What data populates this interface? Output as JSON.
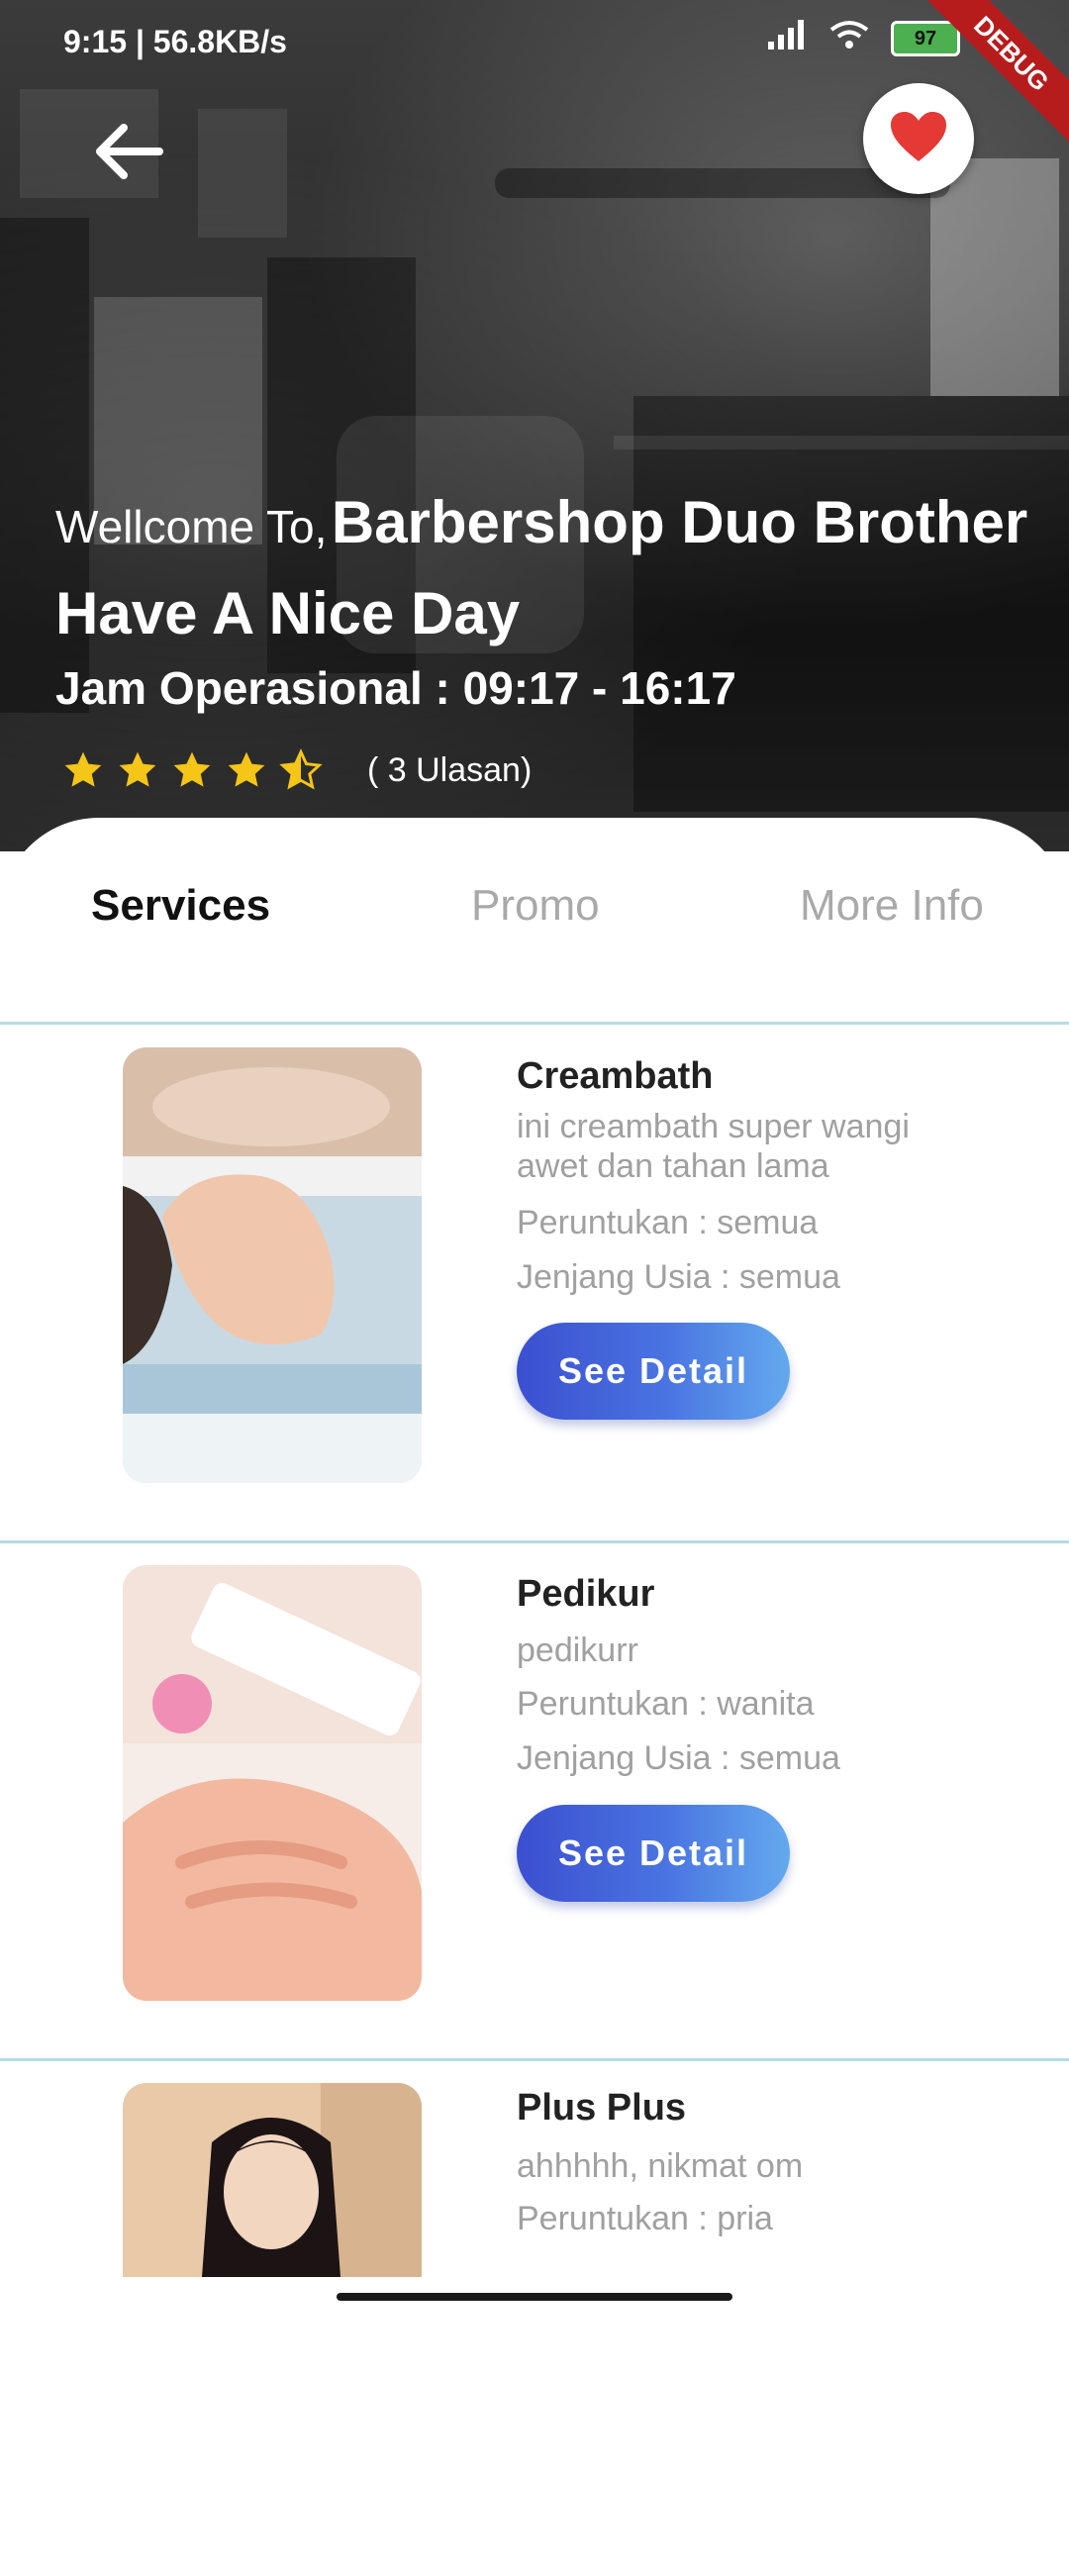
{
  "status_bar": {
    "time_speed": "9:15 | 56.8KB/s",
    "battery": "97"
  },
  "debug_label": "DEBUG",
  "header": {
    "welcome_prefix": "Wellcome To,",
    "shop_name": "Barbershop Duo Brother",
    "greeting": "Have A Nice Day",
    "hours": "Jam Operasional : 09:17 - 16:17",
    "rating": 4.5,
    "reviews": "( 3 Ulasan)"
  },
  "tabs": [
    {
      "label": "Services"
    },
    {
      "label": "Promo"
    },
    {
      "label": "More Info"
    }
  ],
  "services": [
    {
      "name": "Creambath",
      "description": "ini creambath super wangi awet dan tahan lama",
      "for": "Peruntukan : semua",
      "age": "Jenjang Usia : semua",
      "button": "See Detail"
    },
    {
      "name": "Pedikur",
      "description": "pedikurr",
      "for": "Peruntukan : wanita",
      "age": "Jenjang Usia : semua",
      "button": "See Detail"
    },
    {
      "name": "Plus Plus",
      "description": "ahhhhh, nikmat om",
      "for": "Peruntukan : pria"
    }
  ],
  "colors": {
    "accent_start": "#3b4fd0",
    "accent_end": "#63a9ee",
    "heart": "#e53935",
    "star": "#f5c518"
  }
}
